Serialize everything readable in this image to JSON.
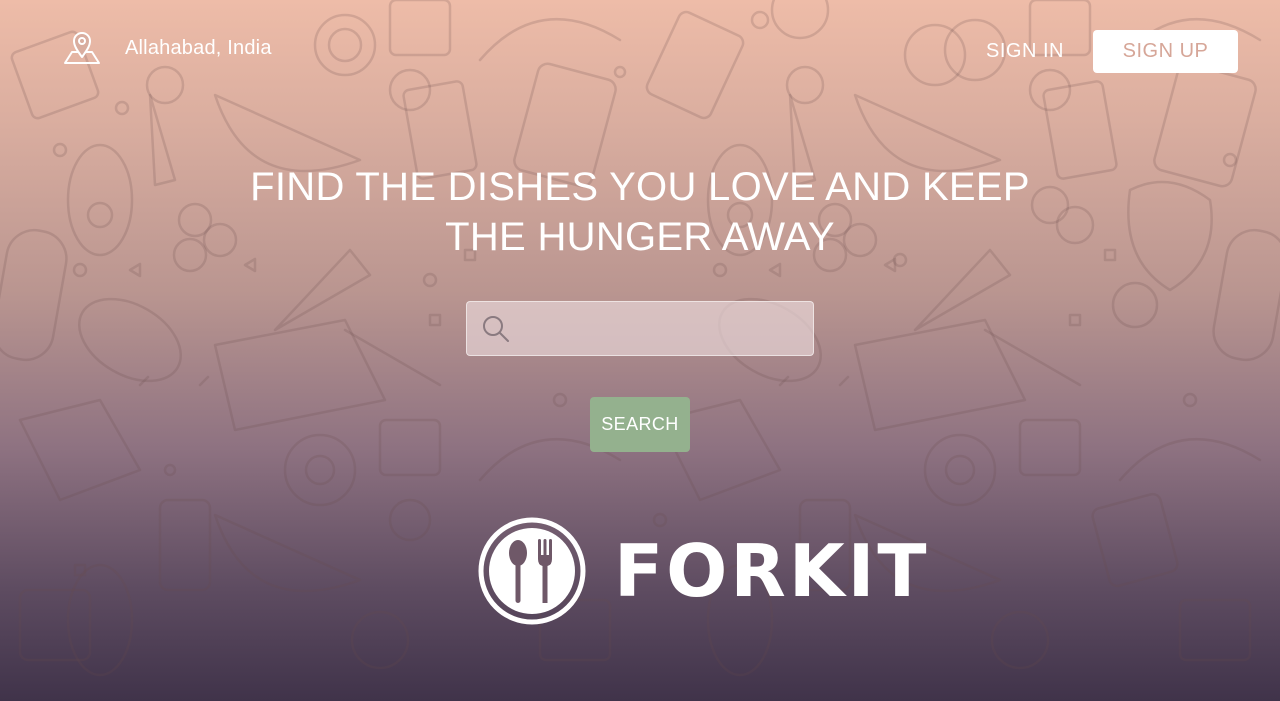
{
  "header": {
    "location": "Allahabad, India",
    "sign_in_label": "SIGN IN",
    "sign_up_label": "SIGN UP"
  },
  "hero": {
    "headline_line1": "FIND THE DISHES YOU LOVE AND KEEP",
    "headline_line2": "THE HUNGER AWAY"
  },
  "search": {
    "value": "",
    "placeholder": "",
    "button_label": "SEARCH"
  },
  "brand": {
    "name": "FORKIT"
  },
  "icons": {
    "location": "map-pin-icon",
    "search": "magnifier-icon",
    "logo": "spoon-fork-logo"
  },
  "colors": {
    "gradient_top": "#eebca8",
    "gradient_bottom": "#40334a",
    "search_button": "#94b18e",
    "sign_up_text": "#d6a698",
    "text": "#ffffff"
  }
}
